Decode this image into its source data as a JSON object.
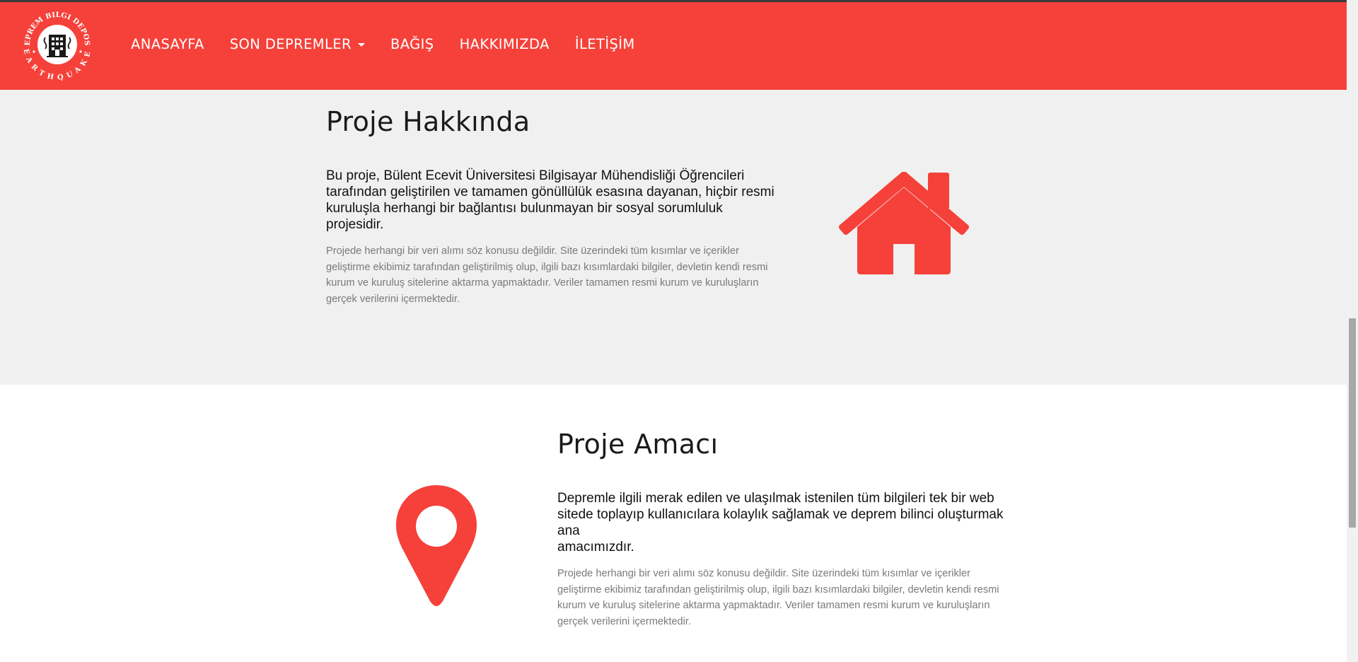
{
  "brand": {
    "logo_top_text": "DEPREM BILGI DEPOSU",
    "logo_bottom_text": "EARTHQUAKE",
    "accent_color": "#f5413a"
  },
  "nav": {
    "items": [
      {
        "label": "ANASAYFA"
      },
      {
        "label": "SON DEPREMLER",
        "has_dropdown": true
      },
      {
        "label": "BAĞIŞ"
      },
      {
        "label": "HAKKIMIZDA"
      },
      {
        "label": "İLETİŞİM"
      }
    ]
  },
  "about": {
    "title": "Proje Hakkında",
    "lead_lines": [
      "Bu proje, Bülent Ecevit Üniversitesi Bilgisayar Mühendisliği Öğrencileri",
      "tarafından geliştirilen ve tamamen gönüllülük esasına dayanan, hiçbir resmi",
      "kuruluşla herhangi bir bağlantısı bulunmayan bir sosyal sorumluluk projesidir."
    ],
    "body_lines": [
      "Projede herhangi bir veri alımı söz konusu değildir. Site üzerindeki tüm kısımlar ve içerikler",
      "geliştirme ekibimiz tarafından geliştirilmiş olup, ilgili bazı kısımlardaki bilgiler, devletin kendi resmi",
      "kurum ve kuruluş sitelerine aktarma yapmaktadır. Veriler tamamen resmi kurum ve kuruluşların",
      "gerçek verilerini içermektedir."
    ],
    "icon": "home-icon"
  },
  "purpose": {
    "title": "Proje Amacı",
    "lead_lines": [
      "Depremle ilgili merak edilen ve ulaşılmak istenilen tüm bilgileri tek bir web",
      "sitede toplayıp kullanıcılara kolaylık sağlamak ve deprem bilinci oluşturmak ana",
      "amacımızdır."
    ],
    "body_lines": [
      "Projede herhangi bir veri alımı söz konusu değildir. Site üzerindeki tüm kısımlar ve içerikler",
      "geliştirme ekibimiz tarafından geliştirilmiş olup, ilgili bazı kısımlardaki bilgiler, devletin kendi resmi",
      "kurum ve kuruluş sitelerine aktarma yapmaktadır. Veriler tamamen resmi kurum ve kuruluşların",
      "gerçek verilerini içermektedir."
    ],
    "icon": "map-pin-icon"
  }
}
